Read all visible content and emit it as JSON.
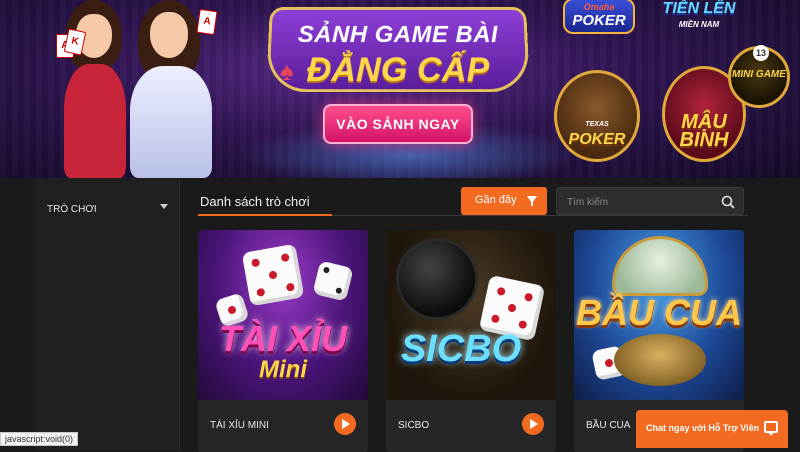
{
  "banner": {
    "title_line1": "SẢNH GAME BÀI",
    "title_line2": "ĐẲNG CẤP",
    "enter_button": "VÀO SẢNH NGAY",
    "games": {
      "omaha_top": "Omaha",
      "omaha_bottom": "POKER",
      "tienlen_top": "TIẾN LÊN",
      "tienlen_bottom": "MIỀN NAM",
      "texas_top": "TEXAS",
      "texas_bottom": "POKER",
      "maubinh": "MẬU BINH",
      "minigame": "MINI GAME",
      "minigame_number": "13"
    }
  },
  "sidebar": {
    "items": [
      {
        "label": "TRÒ CHƠI"
      }
    ]
  },
  "main": {
    "section_title": "Danh sách trò chơi",
    "sort_button": "Gần đây",
    "search_placeholder": "Tìm kiếm",
    "games": [
      {
        "name": "TÀI XỈU MINI",
        "art_title": "TÀI XỈU",
        "art_subtitle": "Mini"
      },
      {
        "name": "SICBO",
        "art_title": "SICBO"
      },
      {
        "name": "BẦU CUA",
        "art_title": "BẦU CUA"
      }
    ]
  },
  "chat": {
    "label": "Chat ngay với Hỗ Trợ Viên"
  },
  "status_bar": {
    "url": "javascript:void(0)"
  },
  "colors": {
    "accent": "#f26b21",
    "background": "#1a1a1a",
    "enter_button": "#d3136a"
  }
}
